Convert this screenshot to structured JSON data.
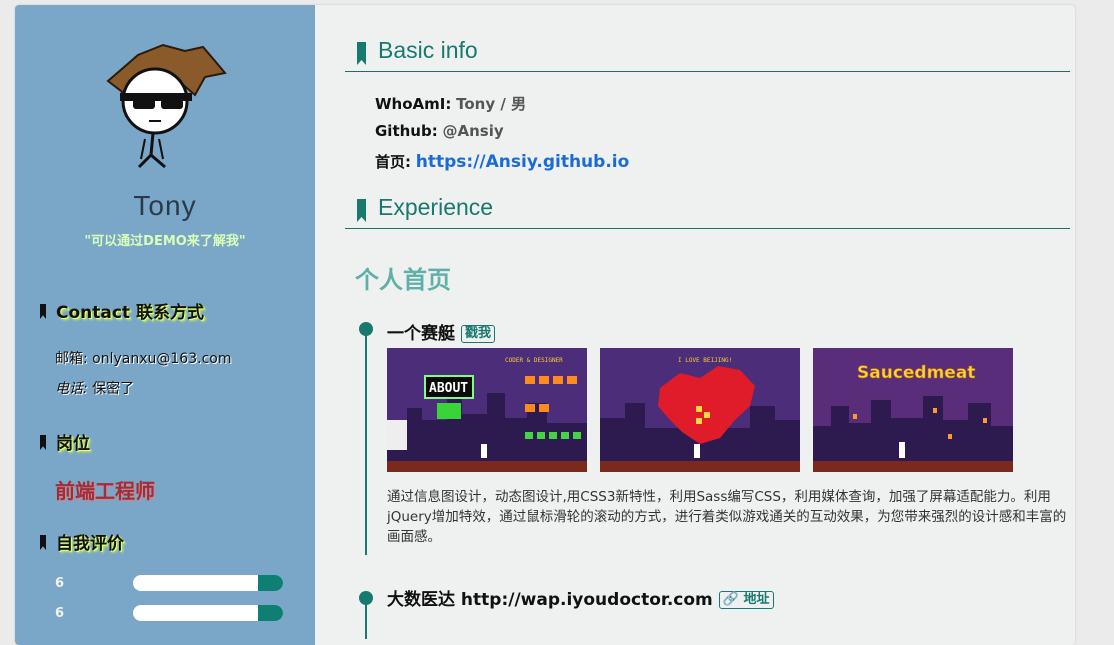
{
  "sidebar": {
    "name": "Tony",
    "motto": "\"可以通过DEMO来了解我\"",
    "contact_heading": "Contact 联系方式",
    "email_label": "邮箱:",
    "email": "onlyanxu@163.com",
    "phone_label": "电话:",
    "phone": "保密了",
    "position_heading": "岗位",
    "position": "前端工程师",
    "self_heading": "自我评价",
    "skills": [
      {
        "score": "6",
        "fill": 0.17
      },
      {
        "score": "6",
        "fill": 0.17
      }
    ]
  },
  "main": {
    "basic_heading": "Basic info",
    "whoami_label": "WhoAmI:",
    "whoami_value": "Tony / 男",
    "github_label": "Github:",
    "github_value": "@Ansiy",
    "home_label": "首页:",
    "home_link": "https://Ansiy.github.io",
    "experience_heading": "Experience",
    "group_title": "个人首页",
    "items": [
      {
        "title": "一个赛艇",
        "tag": "戳我",
        "images": [
          "ABOUT / CODER & DESIGNER",
          "I LOVE BEIJING!",
          "Saucedmeat"
        ],
        "description": "通过信息图设计，动态图设计,用CSS3新特性，利用Sass编写CSS，利用媒体查询，加强了屏幕适配能力。利用jQuery增加特效，通过鼠标滑轮的滚动的方式，进行着类似游戏通关的互动效果，为您带来强烈的设计感和丰富的画面感。"
      },
      {
        "title": "大数医达 http://wap.iyoudoctor.com",
        "tag": "地址"
      }
    ]
  },
  "colors": {
    "sidebar": "#7aa7c8",
    "accent": "#18796e",
    "link": "#1b6bd6",
    "role": "#9a2f3e"
  }
}
